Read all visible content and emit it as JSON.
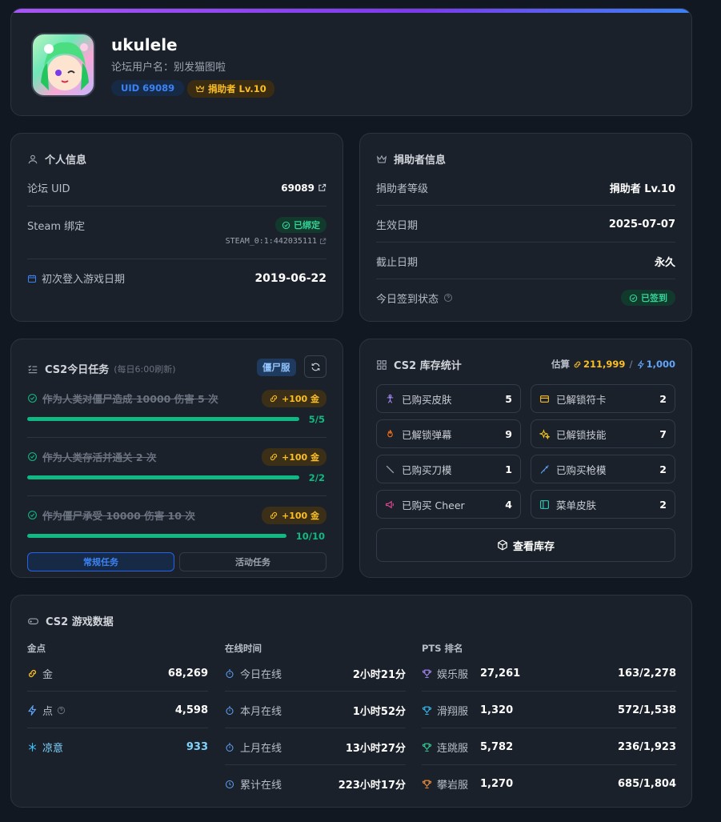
{
  "profile": {
    "name": "ukulele",
    "forum_user": "论坛用户名：别发猫图啦",
    "uid_badge": "UID 69089",
    "donor_badge": "捐助者 Lv.10",
    "accent_top": "#a855f7",
    "accent_right": "#3b82f6"
  },
  "personal": {
    "title": "个人信息",
    "uid_label": "论坛 UID",
    "uid_value": "69089",
    "steam_label": "Steam 绑定",
    "steam_status": "已绑定",
    "steam_id": "STEAM_0:1:442035111",
    "first_login_label": "初次登入游戏日期",
    "first_login_value": "2019-06-22"
  },
  "donor": {
    "title": "捐助者信息",
    "level_label": "捐助者等级",
    "level_value": "捐助者 Lv.10",
    "start_label": "生效日期",
    "start_value": "2025-07-07",
    "end_label": "截止日期",
    "end_value": "永久",
    "checkin_label": "今日签到状态",
    "checkin_value": "已签到"
  },
  "tasks": {
    "title": "CS2今日任务",
    "subtitle": "(每日6:00刷新)",
    "server_tag": "僵尸服",
    "items": [
      {
        "text": "作为人类对僵尸造成 10000 伤害 5 次",
        "reward": "+100 金",
        "progress": "5/5",
        "pct": 1.0
      },
      {
        "text": "作为人类存活并通关 2 次",
        "reward": "+100 金",
        "progress": "2/2",
        "pct": 1.0
      },
      {
        "text": "作为僵尸承受 10000 伤害 10 次",
        "reward": "+100 金",
        "progress": "10/10",
        "pct": 1.0
      }
    ],
    "tab_regular": "常规任务",
    "tab_event": "活动任务"
  },
  "inventory": {
    "title": "CS2 库存统计",
    "est_label": "估算",
    "gold": "211,999",
    "sep": "/",
    "points": "1,000",
    "items": [
      {
        "label": "已购买皮肤",
        "count": "5",
        "icon": "person-icon",
        "color": "#a78bfa"
      },
      {
        "label": "已解锁符卡",
        "count": "2",
        "icon": "card-icon",
        "color": "#fbbf24"
      },
      {
        "label": "已解锁弹幕",
        "count": "9",
        "icon": "flame-icon",
        "color": "#f97316"
      },
      {
        "label": "已解锁技能",
        "count": "7",
        "icon": "sparkle-icon",
        "color": "#facc15"
      },
      {
        "label": "已购买刀模",
        "count": "1",
        "icon": "knife-icon",
        "color": "#9ca3af"
      },
      {
        "label": "已购买枪模",
        "count": "2",
        "icon": "gun-icon",
        "color": "#60a5fa"
      },
      {
        "label": "已购买 Cheer",
        "count": "4",
        "icon": "megaphone-icon",
        "color": "#ec4899"
      },
      {
        "label": "菜单皮肤",
        "count": "2",
        "icon": "panel-icon",
        "color": "#2dd4bf"
      }
    ],
    "view_button": "查看库存"
  },
  "game": {
    "title": "CS2 游戏数据",
    "gold_header": "金点",
    "gold_label": "金",
    "gold_value": "68,269",
    "point_label": "点",
    "point_value": "4,598",
    "cool_label": "凉意",
    "cool_value": "933",
    "online_header": "在线时间",
    "online": [
      {
        "label": "今日在线",
        "value": "2小时21分"
      },
      {
        "label": "本月在线",
        "value": "1小时52分"
      },
      {
        "label": "上月在线",
        "value": "13小时27分"
      },
      {
        "label": "累计在线",
        "value": "223小时17分"
      }
    ],
    "pts_header": "PTS 排名",
    "pts": [
      {
        "server": "娱乐服",
        "score": "27,261",
        "rank": "163/2,278",
        "color": "#a78bfa"
      },
      {
        "server": "滑翔服",
        "score": "1,320",
        "rank": "572/1,538",
        "color": "#38bdf8"
      },
      {
        "server": "连跳服",
        "score": "5,782",
        "rank": "236/1,923",
        "color": "#34d399"
      },
      {
        "server": "攀岩服",
        "score": "1,270",
        "rank": "685/1,804",
        "color": "#fb923c"
      }
    ]
  }
}
